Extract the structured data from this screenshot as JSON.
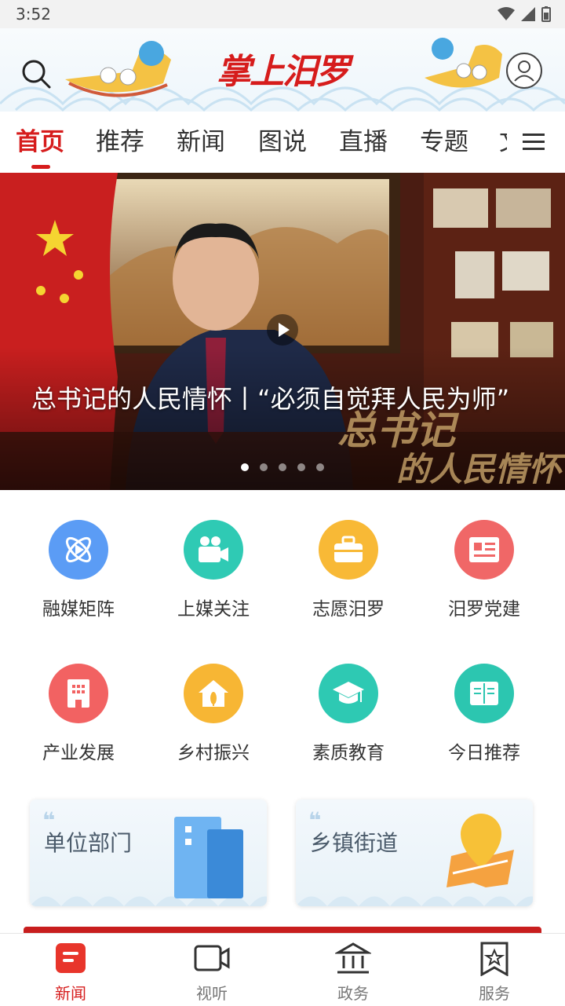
{
  "status_bar": {
    "time": "3:52"
  },
  "header": {
    "logo_text": "掌上汨罗"
  },
  "tabs": [
    {
      "label": "首页",
      "active": true
    },
    {
      "label": "推荐"
    },
    {
      "label": "新闻"
    },
    {
      "label": "图说"
    },
    {
      "label": "直播"
    },
    {
      "label": "专题"
    },
    {
      "label": "文"
    }
  ],
  "banner": {
    "title": "总书记的人民情怀丨“必须自觉拜人民为师”",
    "overlay_text_line1": "总书记",
    "overlay_text_line2": "的人民情怀",
    "dot_count": 5,
    "active_dot": 0
  },
  "grid": [
    {
      "label": "融媒矩阵",
      "icon": "atom-icon",
      "color": "#5b9cf5"
    },
    {
      "label": "上媒关注",
      "icon": "video-camera-icon",
      "color": "#2fcab4"
    },
    {
      "label": "志愿汨罗",
      "icon": "toolbox-icon",
      "color": "#f8b936"
    },
    {
      "label": "汨罗党建",
      "icon": "party-book-icon",
      "color": "#f06767"
    },
    {
      "label": "产业发展",
      "icon": "building-icon",
      "color": "#f26262"
    },
    {
      "label": "乡村振兴",
      "icon": "wheat-house-icon",
      "color": "#f7b634"
    },
    {
      "label": "素质教育",
      "icon": "graduation-cap-icon",
      "color": "#2ec9b3"
    },
    {
      "label": "今日推荐",
      "icon": "open-book-icon",
      "color": "#2cc6b0"
    }
  ],
  "cards": [
    {
      "label": "单位部门",
      "icon": "office-building-icon"
    },
    {
      "label": "乡镇街道",
      "icon": "map-pin-icon"
    }
  ],
  "bottom_nav": [
    {
      "label": "新闻",
      "icon": "news-icon",
      "active": true
    },
    {
      "label": "视听",
      "icon": "video-icon"
    },
    {
      "label": "政务",
      "icon": "government-icon"
    },
    {
      "label": "服务",
      "icon": "service-bookmark-icon"
    }
  ],
  "colors": {
    "accent": "#d61c1c"
  }
}
